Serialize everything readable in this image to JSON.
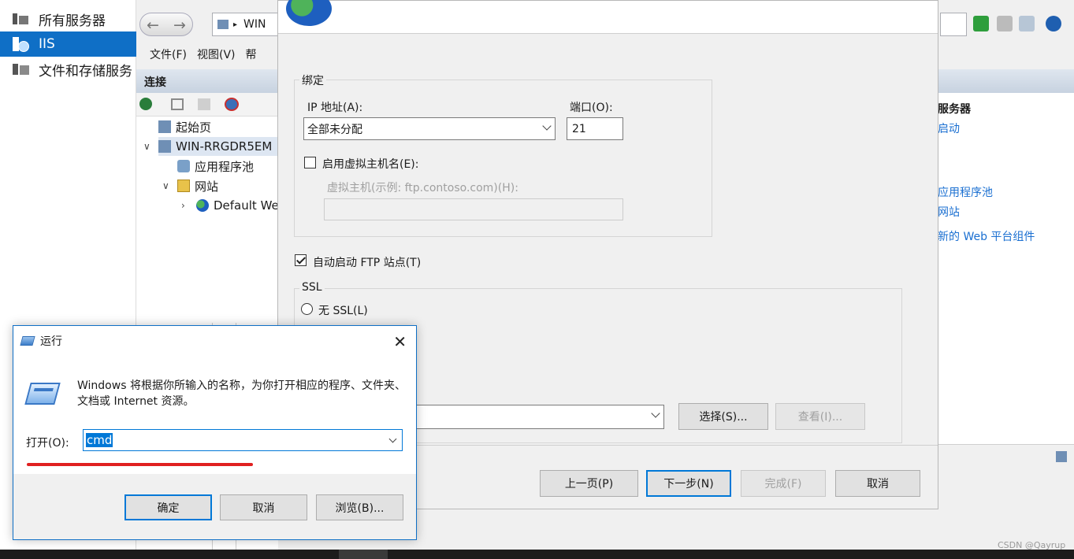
{
  "server_manager": {
    "nav": [
      {
        "label": "所有服务器"
      },
      {
        "label": "IIS"
      },
      {
        "label": "文件和存储服务"
      }
    ]
  },
  "iis": {
    "address": "WIN",
    "menu": [
      "文件(F)",
      "视图(V)",
      "帮"
    ],
    "connections_header": "连接",
    "tree": [
      "起始页",
      "WIN-RRGDR5EM",
      "应用程序池",
      "网站",
      "Default We"
    ],
    "actions": {
      "title": "服务器",
      "links": [
        "启动",
        "应用程序池",
        "网站",
        "新的 Web 平台组件"
      ]
    }
  },
  "wizard": {
    "binding_group": "绑定",
    "ip_label": "IP 地址(A):",
    "ip_value": "全部未分配",
    "port_label": "端口(O):",
    "port_value": "21",
    "virtual_host_checkbox": "启用虚拟主机名(E):",
    "virtual_host_label": "虚拟主机(示例: ftp.contoso.com)(H):",
    "virtual_host_value": "",
    "autostart_checkbox": "自动启动 FTP 站点(T)",
    "ssl_group": "SSL",
    "no_ssl_radio": "无 SSL(L)",
    "select_button": "选择(S)...",
    "view_button": "查看(I)...",
    "buttons": {
      "prev": "上一页(P)",
      "next": "下一步(N)",
      "finish": "完成(F)",
      "cancel": "取消"
    }
  },
  "run_dialog": {
    "title": "运行",
    "description": "Windows 将根据你所输入的名称，为你打开相应的程序、文件夹、文档或 Internet 资源。",
    "open_label": "打开(O):",
    "input_value": "cmd",
    "buttons": {
      "ok": "确定",
      "cancel": "取消",
      "browse": "浏览(B)..."
    }
  },
  "watermark": "CSDN @Qayrup"
}
